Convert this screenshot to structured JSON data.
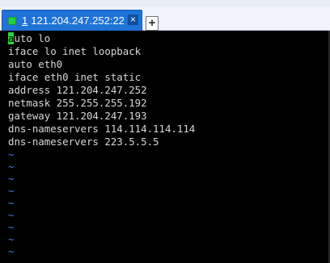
{
  "tab": {
    "number": "1",
    "title": "121.204.247.252:22",
    "close_glyph": "×",
    "status_color": "#26d03a"
  },
  "new_tab_label": "+",
  "editor": {
    "cursor_char": "a",
    "first_line_rest": "uto lo",
    "lines": [
      "iface lo inet loopback",
      "auto eth0",
      "iface eth0 inet static",
      "address 121.204.247.252",
      "netmask 255.255.255.192",
      "gateway 121.204.247.193",
      "dns-nameservers 114.114.114.114",
      "dns-nameservers 223.5.5.5"
    ],
    "empty_marker": "~",
    "empty_line_count": 9
  }
}
